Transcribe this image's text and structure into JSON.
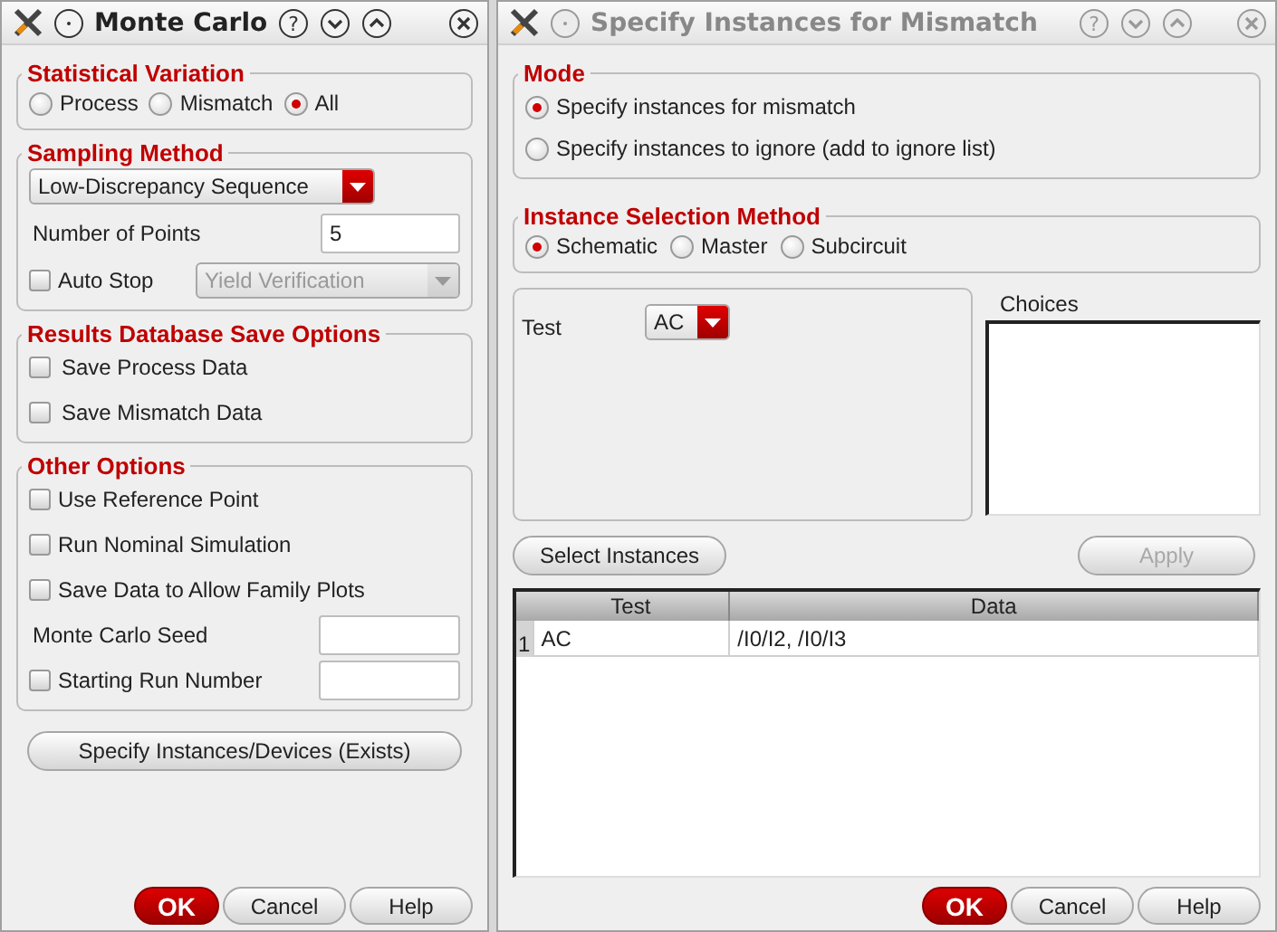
{
  "windows": [
    {
      "kind": "monte_carlo",
      "title": "Monte Carlo",
      "active": true,
      "help_symbol": "?",
      "statistical_variation": {
        "title": "Statistical Variation",
        "options": [
          {
            "label": "Process",
            "selected": false
          },
          {
            "label": "Mismatch",
            "selected": false
          },
          {
            "label": "All",
            "selected": true
          }
        ]
      },
      "sampling_method": {
        "title": "Sampling Method",
        "method": "Low-Discrepancy Sequence",
        "points": {
          "label": "Number of Points",
          "value": "5"
        },
        "auto_stop": {
          "label": "Auto Stop",
          "checked": false,
          "value": "Yield Verification",
          "disabled": true
        }
      },
      "results_database": {
        "title": "Results Database Save Options",
        "items": [
          {
            "label": "Save Process Data",
            "checked": false
          },
          {
            "label": "Save Mismatch Data",
            "checked": false
          }
        ]
      },
      "other_options": {
        "title": "Other Options",
        "rows": [
          {
            "kind": "checkbox",
            "label": "Use Reference Point",
            "checked": false
          },
          {
            "kind": "checkbox",
            "label": "Run Nominal Simulation",
            "checked": false
          },
          {
            "kind": "checkbox",
            "label": "Save Data to Allow Family Plots",
            "checked": false
          },
          {
            "kind": "field",
            "label": "Monte Carlo Seed"
          },
          {
            "kind": "checkfield",
            "label": "Starting Run Number",
            "checked": false
          }
        ]
      },
      "specify_button": "Specify Instances/Devices (Exists)",
      "buttons": [
        {
          "label": "OK",
          "kind": "default"
        },
        {
          "label": "Cancel",
          "kind": "normal"
        },
        {
          "label": "Help",
          "kind": "normal"
        }
      ]
    },
    {
      "kind": "mismatch",
      "title": "Specify Instances for Mismatch",
      "active": false,
      "help_symbol": "?",
      "mode": {
        "title": "Mode",
        "options": [
          {
            "label": "Specify instances for mismatch",
            "selected": true
          },
          {
            "label": "Specify instances to ignore (add to ignore list)",
            "selected": false
          }
        ]
      },
      "selection_method": {
        "title": "Instance Selection Method",
        "options": [
          {
            "label": "Schematic",
            "selected": true
          },
          {
            "label": "Master",
            "selected": false
          },
          {
            "label": "Subcircuit",
            "selected": false
          }
        ]
      },
      "test": {
        "label": "Test",
        "value": "AC"
      },
      "choices": {
        "label": "Choices"
      },
      "select_button": {
        "label": "Select Instances",
        "disabled": false
      },
      "apply_button": {
        "label": "Apply",
        "disabled": true
      },
      "table": {
        "columns": [
          "Test",
          "Data"
        ],
        "rows": [
          {
            "number": "1",
            "cells": [
              "AC",
              "/I0/I2, /I0/I3"
            ]
          }
        ]
      },
      "buttons": [
        {
          "label": "OK",
          "kind": "default"
        },
        {
          "label": "Cancel",
          "kind": "normal"
        },
        {
          "label": "Help",
          "kind": "normal"
        }
      ]
    }
  ]
}
